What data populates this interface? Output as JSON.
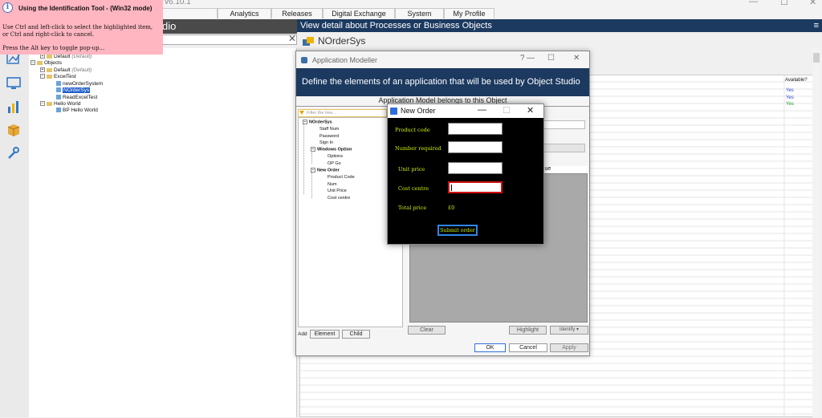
{
  "menubar": {
    "version": "v6.10.1",
    "tabs": [
      "Analytics",
      "Releases",
      "Digital Exchange",
      "System",
      "My Profile"
    ]
  },
  "tree_header": "dio",
  "tree": {
    "rows": [
      {
        "label": "Default",
        "suffix": "(Default)"
      },
      {
        "label": "Objects"
      },
      {
        "label": "Default",
        "suffix": "(Default)"
      },
      {
        "label": "ExcelTest"
      },
      {
        "label": "newOrderSystem"
      },
      {
        "label": "NOrderSys"
      },
      {
        "label": "ReadExcelTest"
      },
      {
        "label": "Hello World"
      },
      {
        "label": "BP Hello World"
      }
    ]
  },
  "detail": {
    "header": "View detail about Processes or Business Objects",
    "title": "NOrderSys",
    "available_header": "Available?",
    "available_values": [
      "Yes",
      "Yes",
      "Yes"
    ]
  },
  "tooltip": {
    "title": "Using the Identification Tool - (Win32 mode)",
    "body": "Use Ctrl and left-click to select the highlighted item, or Ctrl and right-click to cancel.",
    "body2": "Press the Alt key to toggle pop-up..."
  },
  "app_modeller": {
    "title": "Application Modeller",
    "banner": "Define the elements of an application that will be used by Object Studio",
    "subtitle": "Application Model belongs to this Object",
    "filter_placeholder": "Filter the tree...",
    "tree": [
      {
        "label": "NOrderSys",
        "bold": true
      },
      {
        "label": "Staff Num"
      },
      {
        "label": "Password"
      },
      {
        "label": "Sign In"
      },
      {
        "label": "Windows Option",
        "bold": true
      },
      {
        "label": "Options"
      },
      {
        "label": "OP Go"
      },
      {
        "label": "New Order",
        "bold": true
      },
      {
        "label": "Product Code"
      },
      {
        "label": "Num"
      },
      {
        "label": "Unit Price"
      },
      {
        "label": "Cost centre"
      }
    ],
    "add_label": "Add",
    "element_btn": "Element",
    "child_btn": "Child",
    "value_header": "alue",
    "clear_btn": "Clear",
    "highlight_btn": "Highlight",
    "identify_btn": "Identify",
    "ok_btn": "OK",
    "cancel_btn": "Cancel",
    "apply_btn": "Apply"
  },
  "new_order": {
    "title": "New Order",
    "labels": {
      "product_code": "Product code",
      "number_required": "Number required",
      "unit_price": "Unit price",
      "cost_centre": "Cost centre",
      "total_price": "Total price"
    },
    "total_value": "£0",
    "submit": "Submit order"
  }
}
